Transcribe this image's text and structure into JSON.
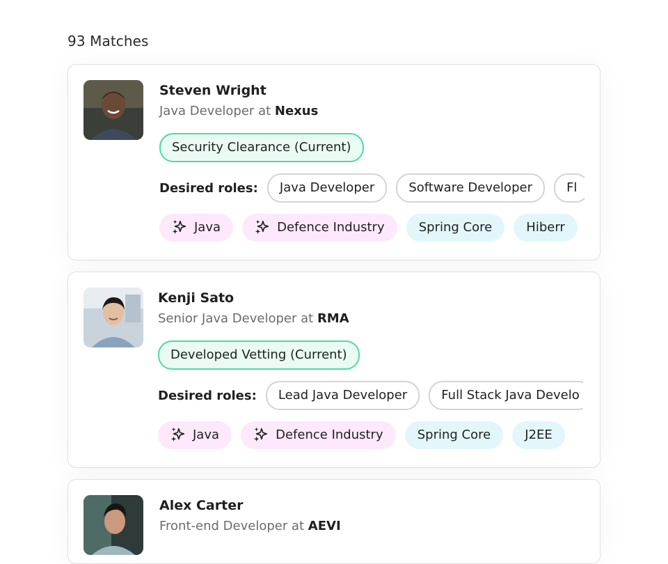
{
  "matches_label": "93 Matches",
  "desired_roles_label": "Desired roles:",
  "candidates": [
    {
      "name": "Steven Wright",
      "title": "Java Developer",
      "at": "at",
      "company": "Nexus",
      "clearance": "Security Clearance (Current)",
      "desired_roles": [
        "Java Developer",
        "Software Developer",
        "Fl"
      ],
      "skills": [
        {
          "label": "Java",
          "ai": true
        },
        {
          "label": "Defence Industry",
          "ai": true
        },
        {
          "label": "Spring Core",
          "ai": false
        },
        {
          "label": "Hiberr",
          "ai": false
        }
      ]
    },
    {
      "name": "Kenji Sato",
      "title": "Senior Java Developer",
      "at": "at",
      "company": "RMA",
      "clearance": "Developed Vetting (Current)",
      "desired_roles": [
        "Lead Java Developer",
        "Full Stack Java Develo"
      ],
      "skills": [
        {
          "label": "Java",
          "ai": true
        },
        {
          "label": "Defence Industry",
          "ai": true
        },
        {
          "label": "Spring Core",
          "ai": false
        },
        {
          "label": "J2EE",
          "ai": false
        }
      ]
    },
    {
      "name": "Alex Carter",
      "title": "Front-end Developer",
      "at": "at",
      "company": "AEVI",
      "clearance": "",
      "desired_roles": [],
      "skills": []
    }
  ],
  "colors": {
    "clearance_border": "#4fd9a8",
    "clearance_bg": "#e9fbf3",
    "ai_skill_bg": "#fde9fb",
    "skill_bg": "#e3f7fb"
  },
  "icons": {
    "ai_skill": "sparkle-icon"
  }
}
